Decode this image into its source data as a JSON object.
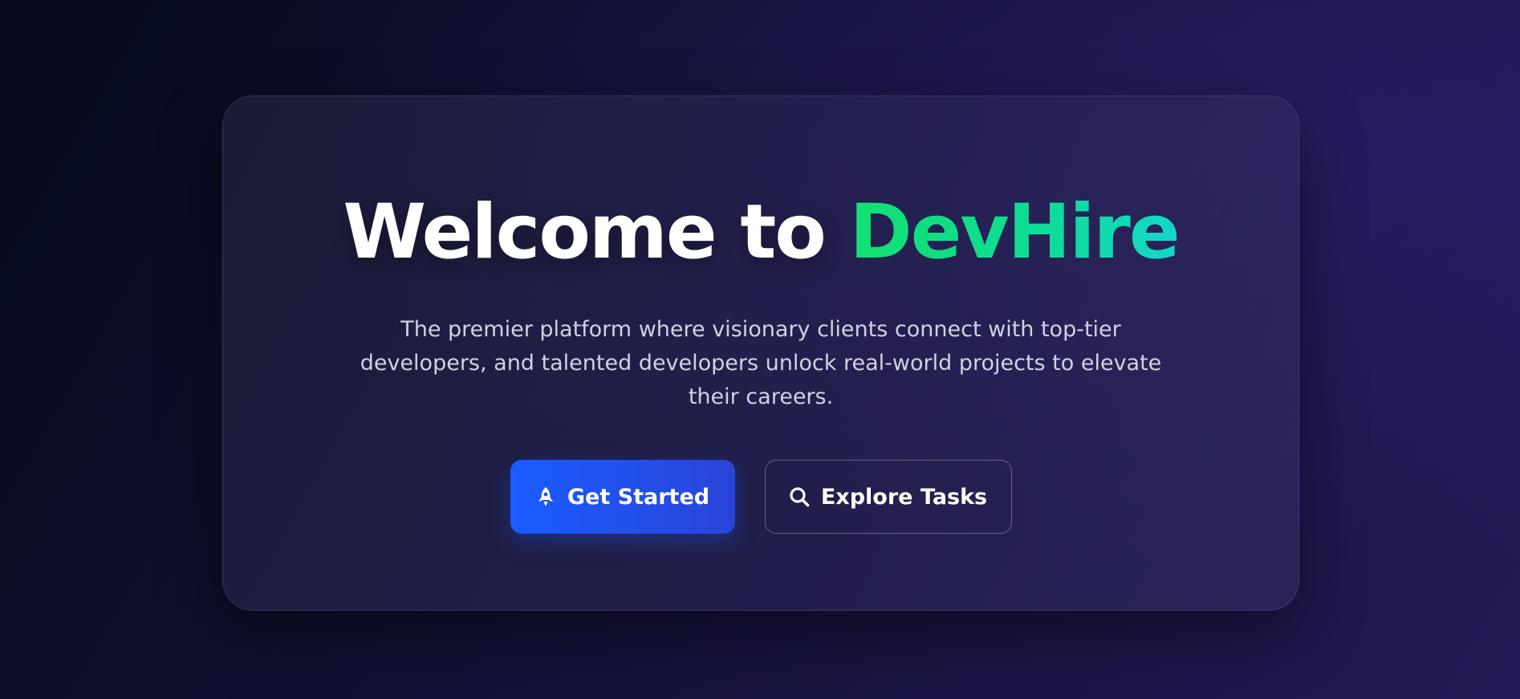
{
  "hero": {
    "title_prefix": "Welcome to ",
    "brand_name": "DevHire",
    "subtitle": "The premier platform where visionary clients connect with top-tier developers, and talented developers unlock real-world projects to elevate their careers."
  },
  "actions": {
    "get_started": {
      "label": "Get Started",
      "icon": "rocket-icon"
    },
    "explore_tasks": {
      "label": "Explore Tasks",
      "icon": "search-icon"
    }
  },
  "colors": {
    "background_start": "#060a1a",
    "background_end": "#241a56",
    "brand_gradient_start": "#12e070",
    "brand_gradient_end": "#14d6c8",
    "primary_button": "#1a5cff",
    "subtitle_text": "#d0d2e2"
  }
}
